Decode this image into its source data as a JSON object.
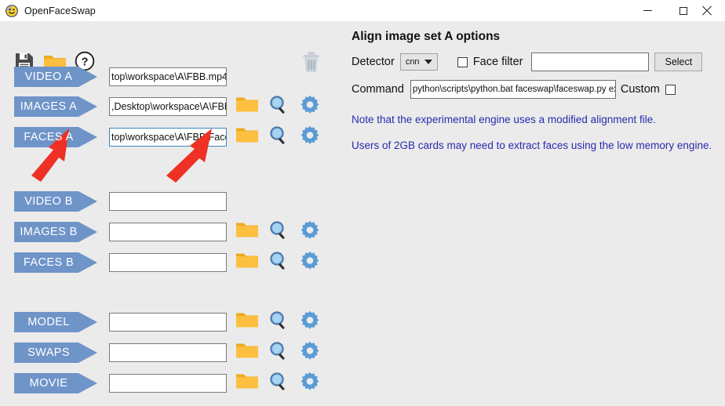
{
  "window": {
    "title": "OpenFaceSwap",
    "app_icon": "smiley-face-icon",
    "controls": {
      "minimize": "minimize-icon",
      "maximize": "maximize-icon",
      "close": "close-icon"
    }
  },
  "toolbar": {
    "items": [
      {
        "name": "save-icon",
        "title": "Save"
      },
      {
        "name": "open-folder-icon",
        "title": "Open"
      },
      {
        "name": "help-icon",
        "title": "Help"
      },
      {
        "name": "trash-icon",
        "title": "Delete",
        "disabled": true
      }
    ]
  },
  "left_panel": {
    "rows": [
      {
        "id": "video-a",
        "label": "VIDEO A",
        "value": "top\\workspace\\A\\FBB.mp4",
        "has_icons": false,
        "focused": false
      },
      {
        "id": "images-a",
        "label": "IMAGES A",
        "value": ",Desktop\\workspace\\A\\FBB",
        "has_icons": true,
        "focused": false
      },
      {
        "id": "faces-a",
        "label": "FACES A",
        "value": "top\\workspace\\A\\FBB\\Face",
        "value_before_caret": "top\\workspace",
        "value_after_caret": "\\A\\FBB\\Face",
        "has_icons": true,
        "focused": true
      },
      {
        "id": "video-b",
        "label": "VIDEO B",
        "value": "",
        "has_icons": false,
        "focused": false
      },
      {
        "id": "images-b",
        "label": "IMAGES B",
        "value": "",
        "has_icons": true,
        "focused": false
      },
      {
        "id": "faces-b",
        "label": "FACES B",
        "value": "",
        "has_icons": true,
        "focused": false
      },
      {
        "id": "model",
        "label": "MODEL",
        "value": "",
        "has_icons": true,
        "focused": false
      },
      {
        "id": "swaps",
        "label": "SWAPS",
        "value": "",
        "has_icons": true,
        "focused": false
      },
      {
        "id": "movie",
        "label": "MOVIE",
        "value": "",
        "has_icons": true,
        "focused": false
      }
    ],
    "row_icons": [
      "folder-icon",
      "magnifier-icon",
      "gear-icon"
    ]
  },
  "right_panel": {
    "title": "Align image set A options",
    "detector_label": "Detector",
    "detector_value": "cnn",
    "detector_options": [
      "cnn"
    ],
    "face_filter_label": "Face filter",
    "face_filter_checked": false,
    "face_filter_value": "",
    "select_button": "Select",
    "command_label": "Command",
    "command_value": "python\\scripts\\python.bat faceswap\\faceswap.py extra",
    "custom_label": "Custom",
    "custom_checked": false,
    "notes": [
      "Note that the experimental engine uses a modified alignment file.",
      "Users of 2GB cards may need to extract faces using the low memory engine."
    ]
  },
  "annotations": {
    "arrows": [
      {
        "name": "annotation-arrow-faces-a-label",
        "color": "#ee3124"
      },
      {
        "name": "annotation-arrow-faces-a-field",
        "color": "#ee3124"
      }
    ]
  },
  "colors": {
    "background": "#ebebeb",
    "tag_blue": "#6f94c8",
    "note_blue": "#2a2ab0",
    "folder_orange": "#f5a623",
    "gear_blue": "#5b9bd5",
    "annotation_red": "#ee3124",
    "focus_border": "#3d86b4"
  }
}
